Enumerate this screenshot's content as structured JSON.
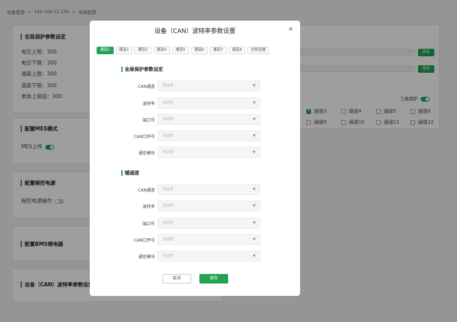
{
  "breadcrumb": [
    "设备管理",
    "192.168.12.199",
    "系统配置"
  ],
  "breadcrumb_sep": ">",
  "cards": {
    "protection": {
      "title": "全局保护参数设定",
      "items": [
        "电压上限：300",
        "电压下限：300",
        "温度上限：300",
        "温度下限：300",
        "单体上限值：300"
      ]
    },
    "mes": {
      "title": "配置MES模式",
      "label": "MES上传",
      "on": true
    },
    "power": {
      "title": "配置程控电源",
      "label": "程控电源操作",
      "on": false
    },
    "bms": {
      "title": "配置BMS继电器"
    },
    "can": {
      "title": "设备（CAN）波特率参数设置"
    }
  },
  "right": {
    "dots": "···",
    "save": "保存",
    "triple_label": "三级保护",
    "channels": [
      {
        "label": "通道3",
        "checked": true
      },
      {
        "label": "通道4",
        "checked": false
      },
      {
        "label": "通道5",
        "checked": false
      },
      {
        "label": "通道6",
        "checked": false
      },
      {
        "label": "通道9",
        "checked": false
      },
      {
        "label": "通道10",
        "checked": false
      },
      {
        "label": "通道11",
        "checked": false
      },
      {
        "label": "通道12",
        "checked": false
      }
    ]
  },
  "modal": {
    "title": "设备（CAN）波特率参数设置",
    "close": "×",
    "tabs": [
      "通道1",
      "通道2",
      "通道3",
      "通道4",
      "通道5",
      "通道6",
      "通道7",
      "通道8",
      "全局设置"
    ],
    "active_tab": 0,
    "section1": "全局保护参数设定",
    "section2": "辅通道",
    "fields": [
      "CAN通道",
      "波特率",
      "端口号",
      "CAN口序号",
      "通信模块"
    ],
    "placeholder": "请选择",
    "cancel": "取消",
    "save": "保存"
  },
  "colors": {
    "accent": "#23a455"
  }
}
